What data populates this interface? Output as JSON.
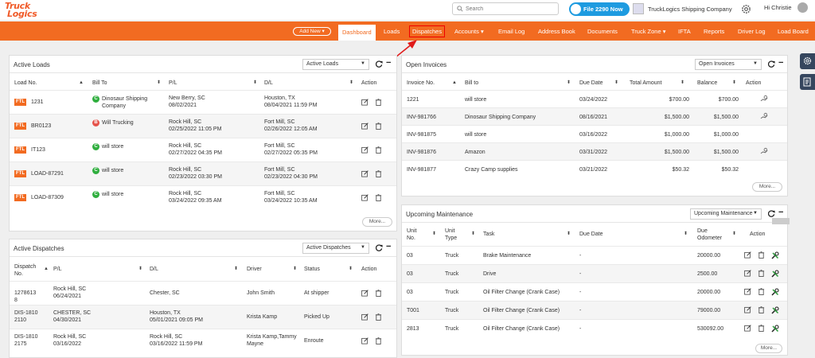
{
  "header": {
    "logo_line1": "Truck",
    "logo_line2": "Logics",
    "search_placeholder": "Search",
    "file2290_label": "File 2290 Now",
    "company_name": "TruckLogics Shipping Company",
    "user_greeting": "Hi Christie"
  },
  "nav": {
    "add_new": "Add New",
    "items": [
      "Dashboard",
      "Loads",
      "Dispatches",
      "Accounts",
      "Email Log",
      "Address Book",
      "Documents",
      "Truck Zone",
      "IFTA",
      "Reports",
      "Driver Log",
      "Load Board"
    ],
    "accent": "#f26b21"
  },
  "active_loads": {
    "title": "Active Loads",
    "select": "Active Loads",
    "columns": [
      "Load No.",
      "Bill To",
      "P/L",
      "D/L",
      "Action"
    ],
    "rows": [
      {
        "type": "FTL",
        "load": "1231",
        "badge": "C",
        "bill_to": "Dinosaur Shipping Company",
        "pl_city": "New Berry, SC",
        "pl_date": "08/02/2021",
        "dl_city": "Houston, TX",
        "dl_date": "08/04/2021 11:59 PM"
      },
      {
        "type": "FTL",
        "load": "BR0123",
        "badge": "B",
        "bill_to": "Will Trucking",
        "pl_city": "Rock Hill, SC",
        "pl_date": "02/25/2022 11:05 PM",
        "dl_city": "Fort Mill, SC",
        "dl_date": "02/26/2022 12:05 AM"
      },
      {
        "type": "FTL",
        "load": "IT123",
        "badge": "C",
        "bill_to": "will store",
        "pl_city": "Rock Hill, SC",
        "pl_date": "02/27/2022 04:35 PM",
        "dl_city": "Fort Mill, SC",
        "dl_date": "02/27/2022 05:35 PM"
      },
      {
        "type": "FTL",
        "load": "LOAD-87291",
        "badge": "C",
        "bill_to": "will store",
        "pl_city": "Rock Hill, SC",
        "pl_date": "02/23/2022 03:30 PM",
        "dl_city": "Fort Mill, SC",
        "dl_date": "02/23/2022 04:30 PM"
      },
      {
        "type": "FTL",
        "load": "LOAD-87309",
        "badge": "C",
        "bill_to": "will store",
        "pl_city": "Rock Hill, SC",
        "pl_date": "03/24/2022 09:35 AM",
        "dl_city": "Fort Mill, SC",
        "dl_date": "03/24/2022 10:35 AM"
      }
    ],
    "more": "More..."
  },
  "active_dispatches": {
    "title": "Active Dispatches",
    "select": "Active Dispatches",
    "columns": [
      "Dispatch No.",
      "P/L",
      "D/L",
      "Driver",
      "Status",
      "Action"
    ],
    "rows": [
      {
        "no": "12786138",
        "pl_city": "Rock Hill, SC",
        "pl_date": "06/24/2021",
        "dl_city": "Chester, SC",
        "dl_date": "",
        "driver": "John Smith",
        "status": "At shipper"
      },
      {
        "no": "DIS-18102110",
        "pl_city": "CHESTER, SC",
        "pl_date": "04/30/2021",
        "dl_city": "Houston, TX",
        "dl_date": "05/01/2021 09:05 PM",
        "driver": "Krista Kamp",
        "status": "Picked Up"
      },
      {
        "no": "DIS-18102175",
        "pl_city": "Rock Hill, SC",
        "pl_date": "03/16/2022",
        "dl_city": "Rock Hill, SC",
        "dl_date": "03/16/2022 11:59 PM",
        "driver": "Krista Kamp,Tammy Mayne",
        "status": "Enroute"
      }
    ]
  },
  "open_invoices": {
    "title": "Open Invoices",
    "select": "Open Invoices",
    "columns": [
      "Invoice No.",
      "Bill to",
      "Due Date",
      "Total Amount",
      "Balance",
      "Action"
    ],
    "rows": [
      {
        "no": "1221",
        "bill_to": "will store",
        "due": "03/24/2022",
        "total": "$700.00",
        "balance": "$700.00",
        "pay": true
      },
      {
        "no": "INV-981766",
        "bill_to": "Dinosaur Shipping Company",
        "due": "08/16/2021",
        "total": "$1,500.00",
        "balance": "$1,500.00",
        "pay": true
      },
      {
        "no": "INV-981875",
        "bill_to": "will store",
        "due": "03/16/2022",
        "total": "$1,000.00",
        "balance": "$1,000.00",
        "pay": false
      },
      {
        "no": "INV-981876",
        "bill_to": "Amazon",
        "due": "03/31/2022",
        "total": "$1,500.00",
        "balance": "$1,500.00",
        "pay": true
      },
      {
        "no": "INV-981877",
        "bill_to": "Crazy Camp supplies",
        "due": "03/21/2022",
        "total": "$50.32",
        "balance": "$50.32",
        "pay": false
      }
    ],
    "more": "More..."
  },
  "upcoming_maintenance": {
    "title": "Upcoming Maintenance",
    "select": "Upcoming Maintenance",
    "columns": [
      "Unit No.",
      "Unit Type",
      "Task",
      "Due Date",
      "Due Odometer",
      "Action"
    ],
    "rows": [
      {
        "unit": "03",
        "type": "Truck",
        "task": "Brake Maintenance",
        "due": "-",
        "odo": "20000.00"
      },
      {
        "unit": "03",
        "type": "Truck",
        "task": "Drive",
        "due": "-",
        "odo": "2500.00"
      },
      {
        "unit": "03",
        "type": "Truck",
        "task": "Oil Filter Change (Crank Case)",
        "due": "-",
        "odo": "20000.00"
      },
      {
        "unit": "T001",
        "type": "Truck",
        "task": "Oil Filter Change (Crank Case)",
        "due": "-",
        "odo": "79000.00"
      },
      {
        "unit": "2813",
        "type": "Truck",
        "task": "Oil Filter Change (Crank Case)",
        "due": "-",
        "odo": "530092.00"
      }
    ],
    "more": "More..."
  }
}
